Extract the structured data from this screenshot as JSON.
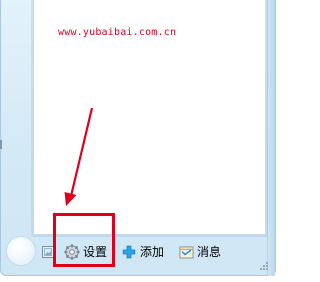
{
  "watermark": {
    "text": "www.yubaibai.com.cn",
    "color": "#e0001b"
  },
  "toolbar": {
    "items": [
      {
        "icon": "picture-icon",
        "label": ""
      },
      {
        "icon": "gear-icon",
        "label": "设置"
      },
      {
        "icon": "plus-icon",
        "label": "添加"
      },
      {
        "icon": "message-icon",
        "label": "消息"
      }
    ]
  },
  "colors": {
    "accent_red": "#e0001b",
    "window_bg": "#d3e9f6",
    "panel_bg": "#ffffff",
    "plus_green": "#1aa0e0"
  },
  "annotations": {
    "highlight_target": "settings-button",
    "arrow_points_to": "settings-button"
  }
}
